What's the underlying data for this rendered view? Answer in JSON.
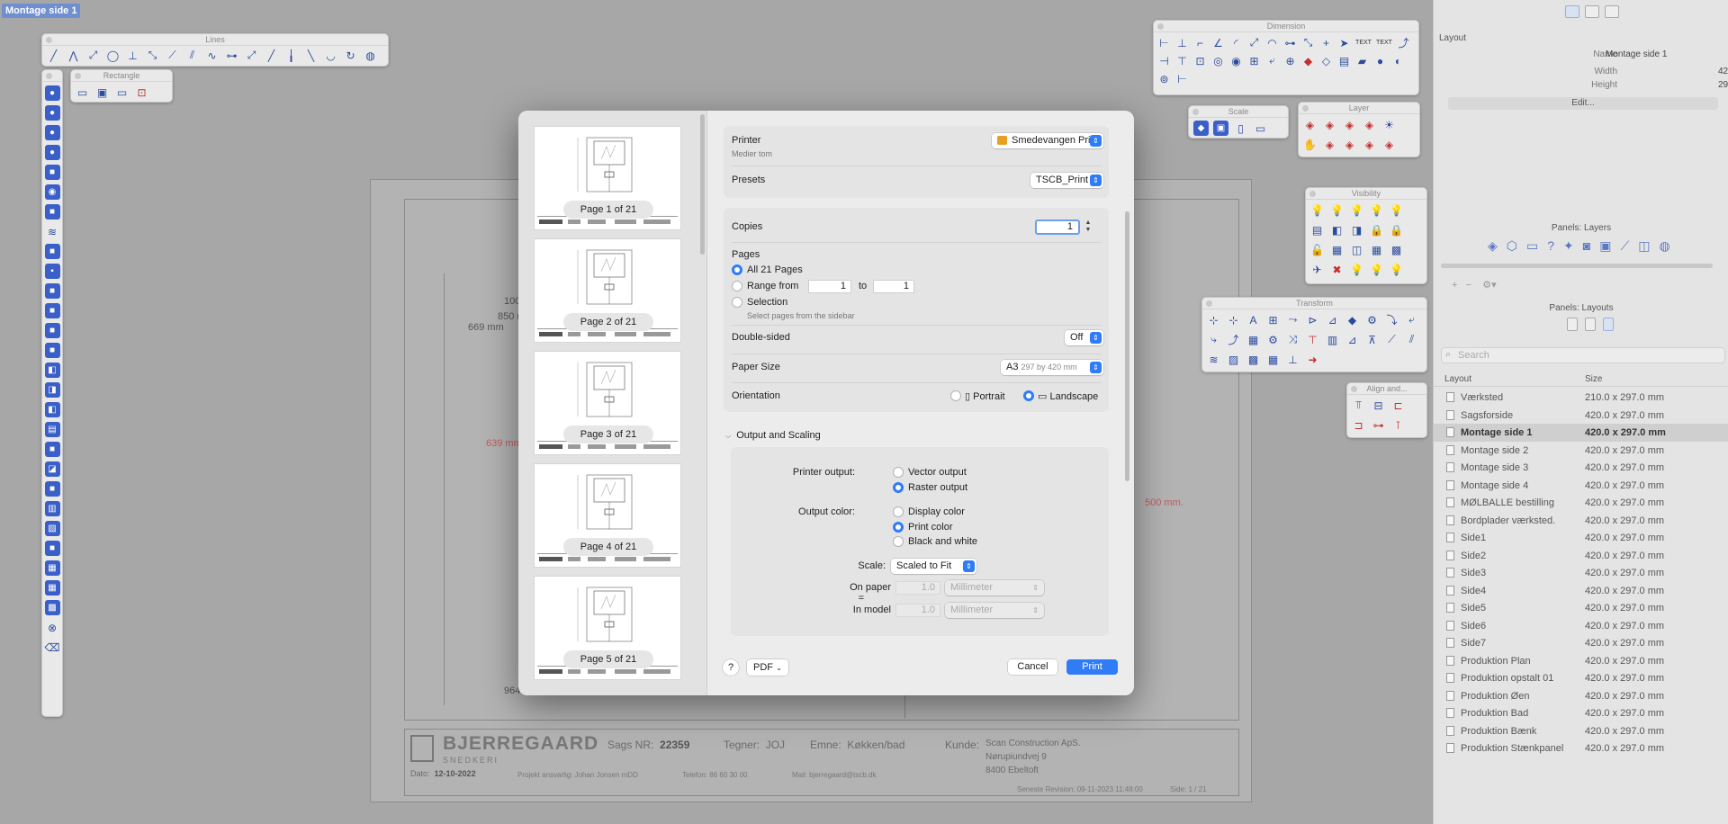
{
  "document_tab": "Montage side 1",
  "palettes": {
    "lines": "Lines",
    "rectangle": "Rectangle",
    "dimension": "Dimension",
    "scale": "Scale",
    "layer": "Layer",
    "visibility": "Visibility",
    "transform": "Transform",
    "align": "Align and...",
    "dimension_text1": "TEXT",
    "dimension_text2": "TEXT"
  },
  "drawing": {
    "dims": [
      "100",
      "850 m",
      "669 mm"
    ],
    "dim_red_left": "639 mm",
    "dim_red_right": "500 mm.",
    "dim_bottom": "964",
    "brand": "BJERREGAARD",
    "brand_sub": "SNEDKERI",
    "sags_label": "Sags NR:",
    "sags_value": "22359",
    "tegner_label": "Tegner:",
    "tegner_value": "JOJ",
    "emne_label": "Emne:",
    "emne_value": "Køkken/bad",
    "kunde_label": "Kunde:",
    "kunde_lines": [
      "Scan Construction ApS.",
      "Nørupiundvej 9",
      "8400 Ebeltoft"
    ],
    "dato_label": "Dato:",
    "dato_value": "12-10-2022",
    "ansvarlig": "Projekt ansvarlig:   Johan Jonsen mDD",
    "telefon": "Telefon:   86 60 30 00",
    "mail": "Mail:   bjerregaard@tscb.dk",
    "seneste": "Seneste Revision:   09-11-2023 11:48:00",
    "side": "Side:   1 / 21"
  },
  "right_panel": {
    "layout_section": "Layout",
    "name_label": "Name",
    "name_value": "Montage side 1",
    "width_label": "Width",
    "width_value": "42",
    "height_label": "Height",
    "height_value": "29",
    "edit_button": "Edit...",
    "layers_title": "Panels: Layers",
    "layouts_title": "Panels: Layouts",
    "search_placeholder": "Search",
    "col_layout": "Layout",
    "col_size": "Size",
    "layouts": [
      {
        "name": "Værksted",
        "size": "210.0 x 297.0 mm"
      },
      {
        "name": "Sagsforside",
        "size": "420.0 x 297.0 mm"
      },
      {
        "name": "Montage side 1",
        "size": "420.0 x 297.0 mm"
      },
      {
        "name": "Montage side 2",
        "size": "420.0 x 297.0 mm"
      },
      {
        "name": "Montage side 3",
        "size": "420.0 x 297.0 mm"
      },
      {
        "name": "Montage side 4",
        "size": "420.0 x 297.0 mm"
      },
      {
        "name": "MØLBALLE bestilling",
        "size": "420.0 x 297.0 mm"
      },
      {
        "name": "Bordplader værksted.",
        "size": "420.0 x 297.0 mm"
      },
      {
        "name": "Side1",
        "size": "420.0 x 297.0 mm"
      },
      {
        "name": "Side2",
        "size": "420.0 x 297.0 mm"
      },
      {
        "name": "Side3",
        "size": "420.0 x 297.0 mm"
      },
      {
        "name": "Side4",
        "size": "420.0 x 297.0 mm"
      },
      {
        "name": "Side5",
        "size": "420.0 x 297.0 mm"
      },
      {
        "name": "Side6",
        "size": "420.0 x 297.0 mm"
      },
      {
        "name": "Side7",
        "size": "420.0 x 297.0 mm"
      },
      {
        "name": "Produktion Plan",
        "size": "420.0 x 297.0 mm"
      },
      {
        "name": "Produktion opstalt 01",
        "size": "420.0 x 297.0 mm"
      },
      {
        "name": "Produktion Øen",
        "size": "420.0 x 297.0 mm"
      },
      {
        "name": "Produktion Bad",
        "size": "420.0 x 297.0 mm"
      },
      {
        "name": "Produktion Bænk",
        "size": "420.0 x 297.0 mm"
      },
      {
        "name": "Produktion Stænkpanel",
        "size": "420.0 x 297.0 mm"
      }
    ]
  },
  "print_dialog": {
    "thumbnails": [
      "Page 1 of 21",
      "Page 2 of 21",
      "Page 3 of 21",
      "Page 4 of 21",
      "Page 5 of 21"
    ],
    "printer_label": "Printer",
    "printer_value": "Smedevangen Print",
    "printer_status": "Medier tom",
    "presets_label": "Presets",
    "presets_value": "TSCB_Print",
    "copies_label": "Copies",
    "copies_value": "1",
    "pages_label": "Pages",
    "all_pages": "All 21 Pages",
    "range_from": "Range from",
    "range_start": "1",
    "range_to": "to",
    "range_end": "1",
    "selection": "Selection",
    "selection_hint": "Select pages from the sidebar",
    "double_sided_label": "Double-sided",
    "double_sided_value": "Off",
    "paper_size_label": "Paper Size",
    "paper_size_value": "A3",
    "paper_size_dims": "297 by 420 mm",
    "orientation_label": "Orientation",
    "portrait": "Portrait",
    "landscape": "Landscape",
    "output_scaling": "Output and Scaling",
    "printer_output_label": "Printer output:",
    "vector_output": "Vector output",
    "raster_output": "Raster output",
    "output_color_label": "Output color:",
    "display_color": "Display color",
    "print_color": "Print color",
    "black_white": "Black and white",
    "scale_label": "Scale:",
    "scale_value": "Scaled to Fit",
    "on_paper_label": "On paper",
    "equals": "=",
    "in_model_label": "In model",
    "on_paper_value": "1.0",
    "in_model_value": "1.0",
    "unit_value": "Millimeter",
    "help": "?",
    "pdf": "PDF",
    "cancel": "Cancel",
    "print": "Print"
  }
}
